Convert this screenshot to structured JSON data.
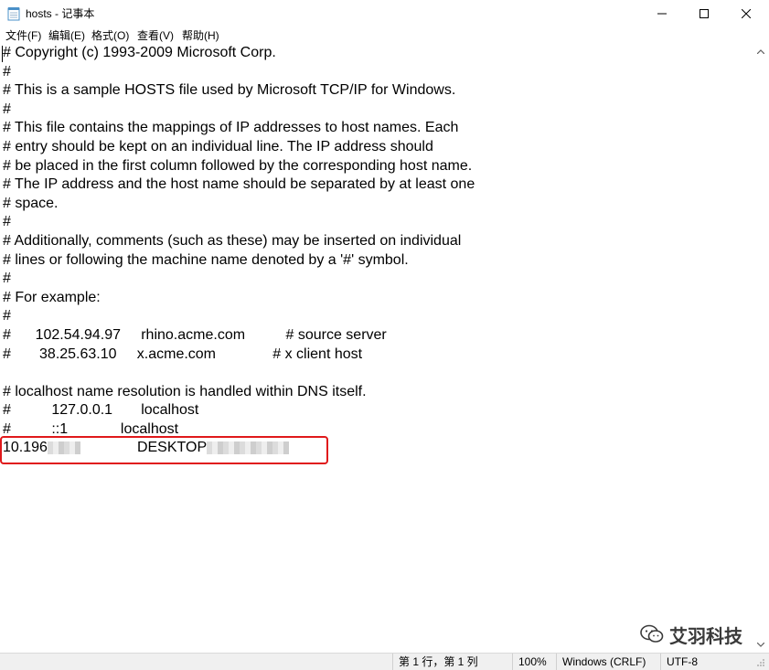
{
  "window": {
    "title": "hosts - 记事本"
  },
  "menu": {
    "items": [
      {
        "label": "文件(F)"
      },
      {
        "label": "编辑(E)"
      },
      {
        "label": "格式(O)"
      },
      {
        "label": "查看(V)"
      },
      {
        "label": "帮助(H)"
      }
    ]
  },
  "editor": {
    "lines": [
      "# Copyright (c) 1993-2009 Microsoft Corp.",
      "#",
      "# This is a sample HOSTS file used by Microsoft TCP/IP for Windows.",
      "#",
      "# This file contains the mappings of IP addresses to host names. Each",
      "# entry should be kept on an individual line. The IP address should",
      "# be placed in the first column followed by the corresponding host name.",
      "# The IP address and the host name should be separated by at least one",
      "# space.",
      "#",
      "# Additionally, comments (such as these) may be inserted on individual",
      "# lines or following the machine name denoted by a '#' symbol.",
      "#",
      "# For example:",
      "#",
      "#      102.54.94.97     rhino.acme.com          # source server",
      "#       38.25.63.10     x.acme.com              # x client host",
      "",
      "# localhost name resolution is handled within DNS itself.",
      "#\t    127.0.0.1       localhost",
      "#\t    ::1             localhost"
    ],
    "custom_entry": {
      "ip_visible": "10.196",
      "host_visible": "DESKTOP"
    }
  },
  "statusbar": {
    "position": "第 1 行，第 1 列",
    "zoom": "100%",
    "line_ending": "Windows (CRLF)",
    "encoding": "UTF-8"
  },
  "watermark": {
    "text": "艾羽科技"
  }
}
